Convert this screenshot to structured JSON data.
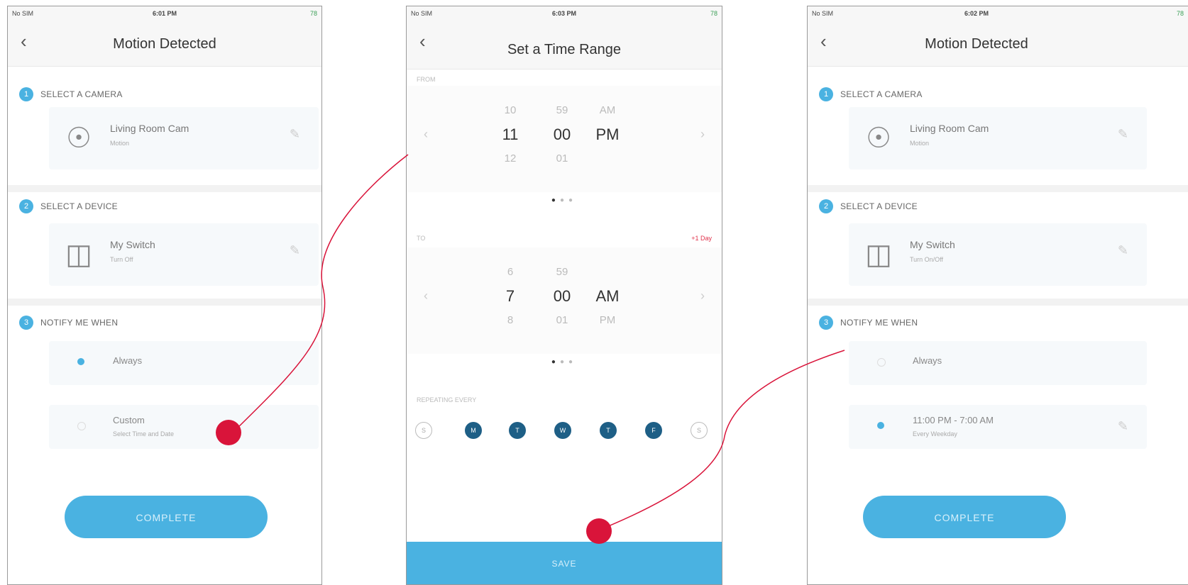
{
  "screens": {
    "left": {
      "status": {
        "carrier": "No SIM",
        "time": "6:01 PM",
        "battery": "78"
      },
      "title": "Motion Detected",
      "sections": [
        {
          "number": "1",
          "label": "SELECT A CAMERA"
        },
        {
          "number": "2",
          "label": "SELECT A DEVICE"
        },
        {
          "number": "3",
          "label": "NOTIFY ME WHEN"
        }
      ],
      "camera": {
        "name": "Living Room Cam",
        "sub": "Motion"
      },
      "device": {
        "name": "My Switch",
        "sub": "Turn Off"
      },
      "options": [
        {
          "label": "Always"
        },
        {
          "label": "Custom",
          "sub": "Select Time and Date"
        }
      ],
      "complete_label": "COMPLETE"
    },
    "middle": {
      "status": {
        "carrier": "No SIM",
        "time": "6:03 PM",
        "battery": "78"
      },
      "title": "Set a Time Range",
      "from_label": "FROM",
      "to_label": "TO",
      "plus_day": "+1 Day",
      "from_picker": {
        "hour": [
          "10",
          "11",
          "12"
        ],
        "minute": [
          "59",
          "00",
          "01"
        ],
        "ampm": [
          "AM",
          "PM",
          ""
        ]
      },
      "to_picker": {
        "hour": [
          "6",
          "7",
          "8"
        ],
        "minute": [
          "59",
          "00",
          "01"
        ],
        "ampm": [
          "",
          "AM",
          "PM"
        ]
      },
      "repeat_label": "REPEATING EVERY",
      "days": [
        {
          "letter": "S",
          "active": false
        },
        {
          "letter": "M",
          "active": true
        },
        {
          "letter": "T",
          "active": true
        },
        {
          "letter": "W",
          "active": true
        },
        {
          "letter": "T",
          "active": true
        },
        {
          "letter": "F",
          "active": true
        },
        {
          "letter": "S",
          "active": false
        }
      ],
      "save_label": "SAVE"
    },
    "right": {
      "status": {
        "carrier": "No SIM",
        "time": "6:02 PM",
        "battery": "78"
      },
      "title": "Motion Detected",
      "sections": [
        {
          "number": "1",
          "label": "SELECT A CAMERA"
        },
        {
          "number": "2",
          "label": "SELECT A DEVICE"
        },
        {
          "number": "3",
          "label": "NOTIFY ME WHEN"
        }
      ],
      "camera": {
        "name": "Living Room Cam",
        "sub": "Motion"
      },
      "device": {
        "name": "My Switch",
        "sub": "Turn On/Off"
      },
      "options": [
        {
          "label": "Always"
        },
        {
          "label": "11:00 PM - 7:00 AM",
          "sub": "Every Weekday"
        }
      ],
      "complete_label": "COMPLETE"
    }
  },
  "colors": {
    "accent": "#4ab2e1",
    "marker": "#d9143a",
    "day_active": "#1e5f86"
  },
  "icons": {
    "camera": "camera-icon",
    "switch": "switch-icon",
    "edit": "pencil-icon",
    "back": "chevron-left-icon"
  }
}
